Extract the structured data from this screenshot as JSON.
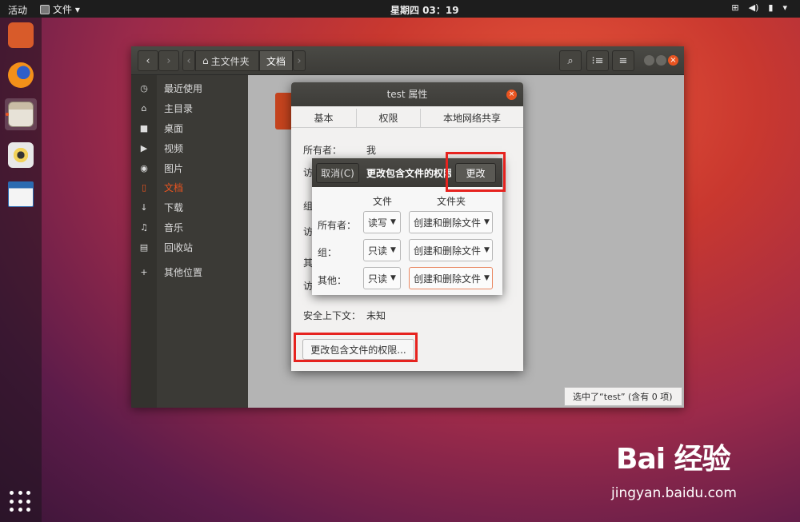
{
  "topbar": {
    "activities": "活动",
    "app_menu": "文件 ▾",
    "clock": "星期四 03：19"
  },
  "dock": {
    "items": [
      "ubuntu-software",
      "firefox",
      "files",
      "rhythmbox",
      "libreoffice-writer"
    ]
  },
  "window": {
    "breadcrumbs": [
      "主文件夹",
      "文档"
    ],
    "sidebar": [
      {
        "icon": "clock-icon",
        "label": "最近使用"
      },
      {
        "icon": "home-icon",
        "label": "主目录"
      },
      {
        "icon": "folder-icon",
        "label": "桌面"
      },
      {
        "icon": "video-icon",
        "label": "视频"
      },
      {
        "icon": "camera-icon",
        "label": "图片"
      },
      {
        "icon": "document-icon",
        "label": "文档"
      },
      {
        "icon": "download-icon",
        "label": "下载"
      },
      {
        "icon": "music-icon",
        "label": "音乐"
      },
      {
        "icon": "trash-icon",
        "label": "回收站"
      },
      {
        "icon": "plus-icon",
        "label": "其他位置"
      }
    ],
    "status": "选中了“test” (含有 0 项)"
  },
  "properties": {
    "title": "test 属性",
    "tabs": [
      "基本",
      "权限",
      "本地网络共享"
    ],
    "owner_label": "所有者：",
    "owner_value": "我",
    "partial_labels": [
      "访",
      "组",
      "访",
      "其",
      "访"
    ],
    "security_label": "安全上下文：",
    "security_value": "未知",
    "change_button": "更改包含文件的权限..."
  },
  "perm_dialog": {
    "cancel": "取消(C)",
    "title": "更改包含文件的权限",
    "change": "更改",
    "col_file": "文件",
    "col_folder": "文件夹",
    "rows": [
      {
        "label": "所有者：",
        "file": "读写",
        "folder": "创建和删除文件"
      },
      {
        "label": "组：",
        "file": "只读",
        "folder": "创建和删除文件"
      },
      {
        "label": "其他：",
        "file": "只读",
        "folder": "创建和删除文件"
      }
    ]
  },
  "watermark": {
    "brand": "Bai  经验",
    "url": "jingyan.baidu.com"
  },
  "colors": {
    "accent": "#e95420",
    "highlight": "#e6231f"
  }
}
